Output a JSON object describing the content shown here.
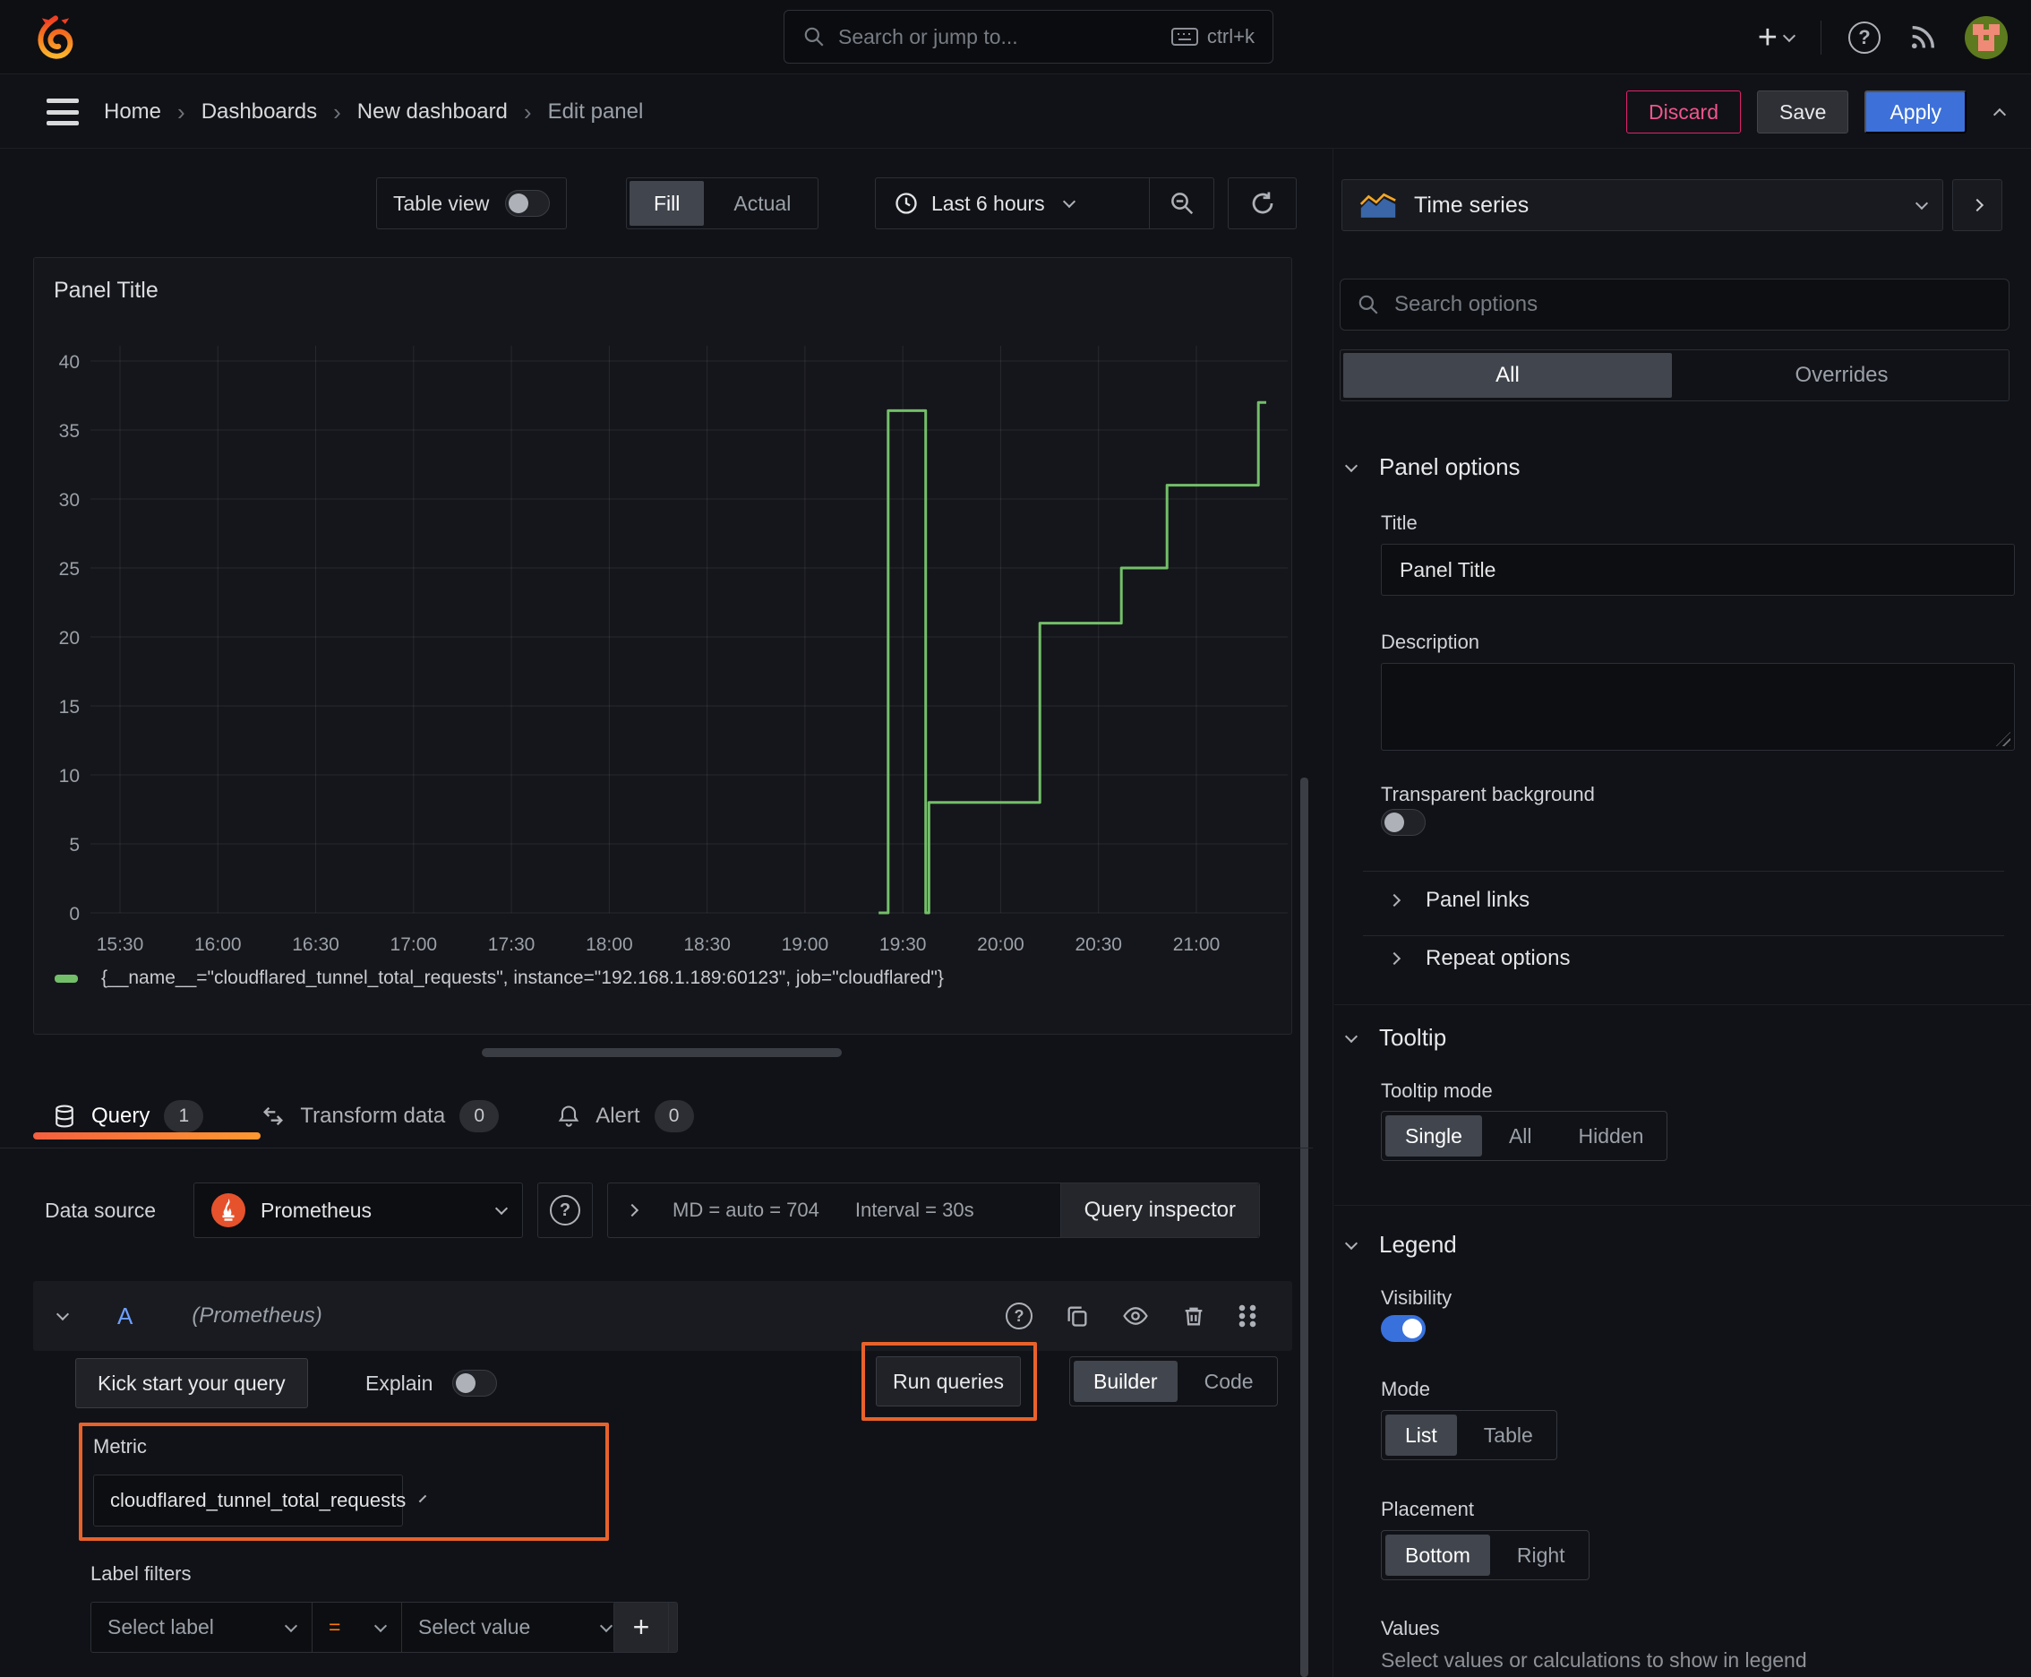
{
  "topbar": {
    "search_placeholder": "Search or jump to...",
    "search_shortcut": "ctrl+k"
  },
  "breadcrumb": {
    "items": [
      "Home",
      "Dashboards",
      "New dashboard"
    ],
    "current": "Edit panel",
    "discard_label": "Discard",
    "save_label": "Save",
    "apply_label": "Apply"
  },
  "toolbar": {
    "table_view_label": "Table view",
    "fill_label": "Fill",
    "actual_label": "Actual",
    "time_range_label": "Last 6 hours"
  },
  "panel": {
    "title": "Panel Title"
  },
  "chart_data": {
    "type": "line",
    "step": true,
    "title": "Panel Title",
    "xlabel": "",
    "ylabel": "",
    "grid": true,
    "legend_position": "bottom",
    "ylim": [
      0,
      41
    ],
    "xlim_minutes": [
      -9,
      358
    ],
    "x_unit": "minutes_since_15:30",
    "y_ticks": [
      0,
      5,
      10,
      15,
      20,
      25,
      30,
      35,
      40
    ],
    "x_ticks": [
      {
        "min": 0,
        "label": "15:30"
      },
      {
        "min": 30,
        "label": "16:00"
      },
      {
        "min": 60,
        "label": "16:30"
      },
      {
        "min": 90,
        "label": "17:00"
      },
      {
        "min": 120,
        "label": "17:30"
      },
      {
        "min": 150,
        "label": "18:00"
      },
      {
        "min": 180,
        "label": "18:30"
      },
      {
        "min": 210,
        "label": "19:00"
      },
      {
        "min": 240,
        "label": "19:30"
      },
      {
        "min": 270,
        "label": "20:00"
      },
      {
        "min": 300,
        "label": "20:30"
      },
      {
        "min": 330,
        "label": "21:00"
      }
    ],
    "series": [
      {
        "name": "{__name__=\"cloudflared_tunnel_total_requests\", instance=\"192.168.1.189:60123\", job=\"cloudflared\"}",
        "color": "#73bf69",
        "vertices": [
          [
            233,
            0
          ],
          [
            235.5,
            0
          ],
          [
            235.5,
            36.4
          ],
          [
            247,
            36.4
          ],
          [
            247,
            0
          ],
          [
            248,
            0
          ],
          [
            248,
            8
          ],
          [
            282,
            8
          ],
          [
            282,
            21
          ],
          [
            307,
            21
          ],
          [
            307,
            25
          ],
          [
            321,
            25
          ],
          [
            321,
            31
          ],
          [
            349,
            31
          ],
          [
            349,
            37
          ],
          [
            351,
            37
          ]
        ]
      }
    ]
  },
  "tabs": {
    "query": {
      "label": "Query",
      "badge": "1"
    },
    "transform": {
      "label": "Transform data",
      "badge": "0"
    },
    "alert": {
      "label": "Alert",
      "badge": "0"
    }
  },
  "query_editor": {
    "datasource_label": "Data source",
    "datasource_value": "Prometheus",
    "stats_md": "MD = auto = 704",
    "stats_interval": "Interval = 30s",
    "inspector_label": "Query inspector",
    "ref_id": "A",
    "ref_ds": "(Prometheus)",
    "kick_start_label": "Kick start your query",
    "explain_label": "Explain",
    "run_queries_label": "Run queries",
    "builder_label": "Builder",
    "code_label": "Code",
    "metric_label": "Metric",
    "metric_value": "cloudflared_tunnel_total_requests",
    "label_filters_label": "Label filters",
    "select_label_placeholder": "Select label",
    "operator": "=",
    "select_value_placeholder": "Select value",
    "remove_symbol": "×",
    "add_symbol": "+"
  },
  "sidebar": {
    "viz_name": "Time series",
    "search_placeholder": "Search options",
    "tab_all": "All",
    "tab_overrides": "Overrides",
    "panel_options": {
      "heading": "Panel options",
      "title_label": "Title",
      "title_value": "Panel Title",
      "description_label": "Description",
      "transparent_label": "Transparent background"
    },
    "panel_links_label": "Panel links",
    "repeat_options_label": "Repeat options",
    "tooltip": {
      "heading": "Tooltip",
      "mode_label": "Tooltip mode",
      "options": [
        "Single",
        "All",
        "Hidden"
      ],
      "selected": "Single"
    },
    "legend": {
      "heading": "Legend",
      "visibility_label": "Visibility",
      "mode_label": "Mode",
      "mode_options": [
        "List",
        "Table"
      ],
      "placement_label": "Placement",
      "placement_options": [
        "Bottom",
        "Right"
      ],
      "values_label": "Values",
      "values_help": "Select values or calculations to show in legend"
    }
  }
}
